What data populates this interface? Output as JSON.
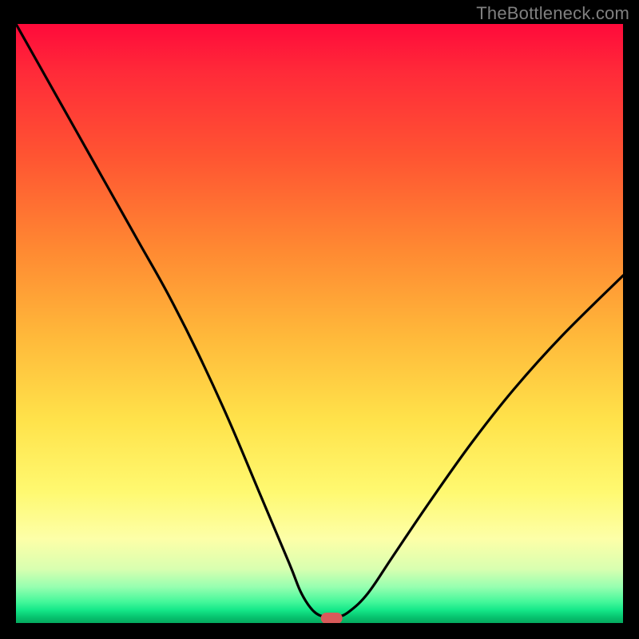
{
  "watermark": "TheBottleneck.com",
  "chart_data": {
    "type": "line",
    "title": "",
    "xlabel": "",
    "ylabel": "",
    "xlim": [
      0,
      100
    ],
    "ylim": [
      0,
      100
    ],
    "grid": false,
    "series": [
      {
        "name": "bottleneck-curve",
        "x": [
          0,
          5,
          10,
          15,
          20,
          25,
          30,
          35,
          40,
          45,
          47,
          49,
          51,
          53,
          55,
          58,
          62,
          68,
          75,
          82,
          90,
          100
        ],
        "y": [
          100,
          91,
          82,
          73,
          64,
          55,
          45,
          34,
          22,
          10,
          5,
          2,
          1,
          1,
          2,
          5,
          11,
          20,
          30,
          39,
          48,
          58
        ]
      }
    ],
    "marker": {
      "x": 52,
      "y": 0.8,
      "shape": "pill",
      "color": "#d85a5a"
    },
    "background_gradient": {
      "stops": [
        {
          "pos": 0,
          "color": "#ff0a3a"
        },
        {
          "pos": 0.22,
          "color": "#ff5432"
        },
        {
          "pos": 0.52,
          "color": "#ffb83a"
        },
        {
          "pos": 0.78,
          "color": "#fff970"
        },
        {
          "pos": 0.94,
          "color": "#96ffb0"
        },
        {
          "pos": 1.0,
          "color": "#05a85f"
        }
      ]
    }
  }
}
